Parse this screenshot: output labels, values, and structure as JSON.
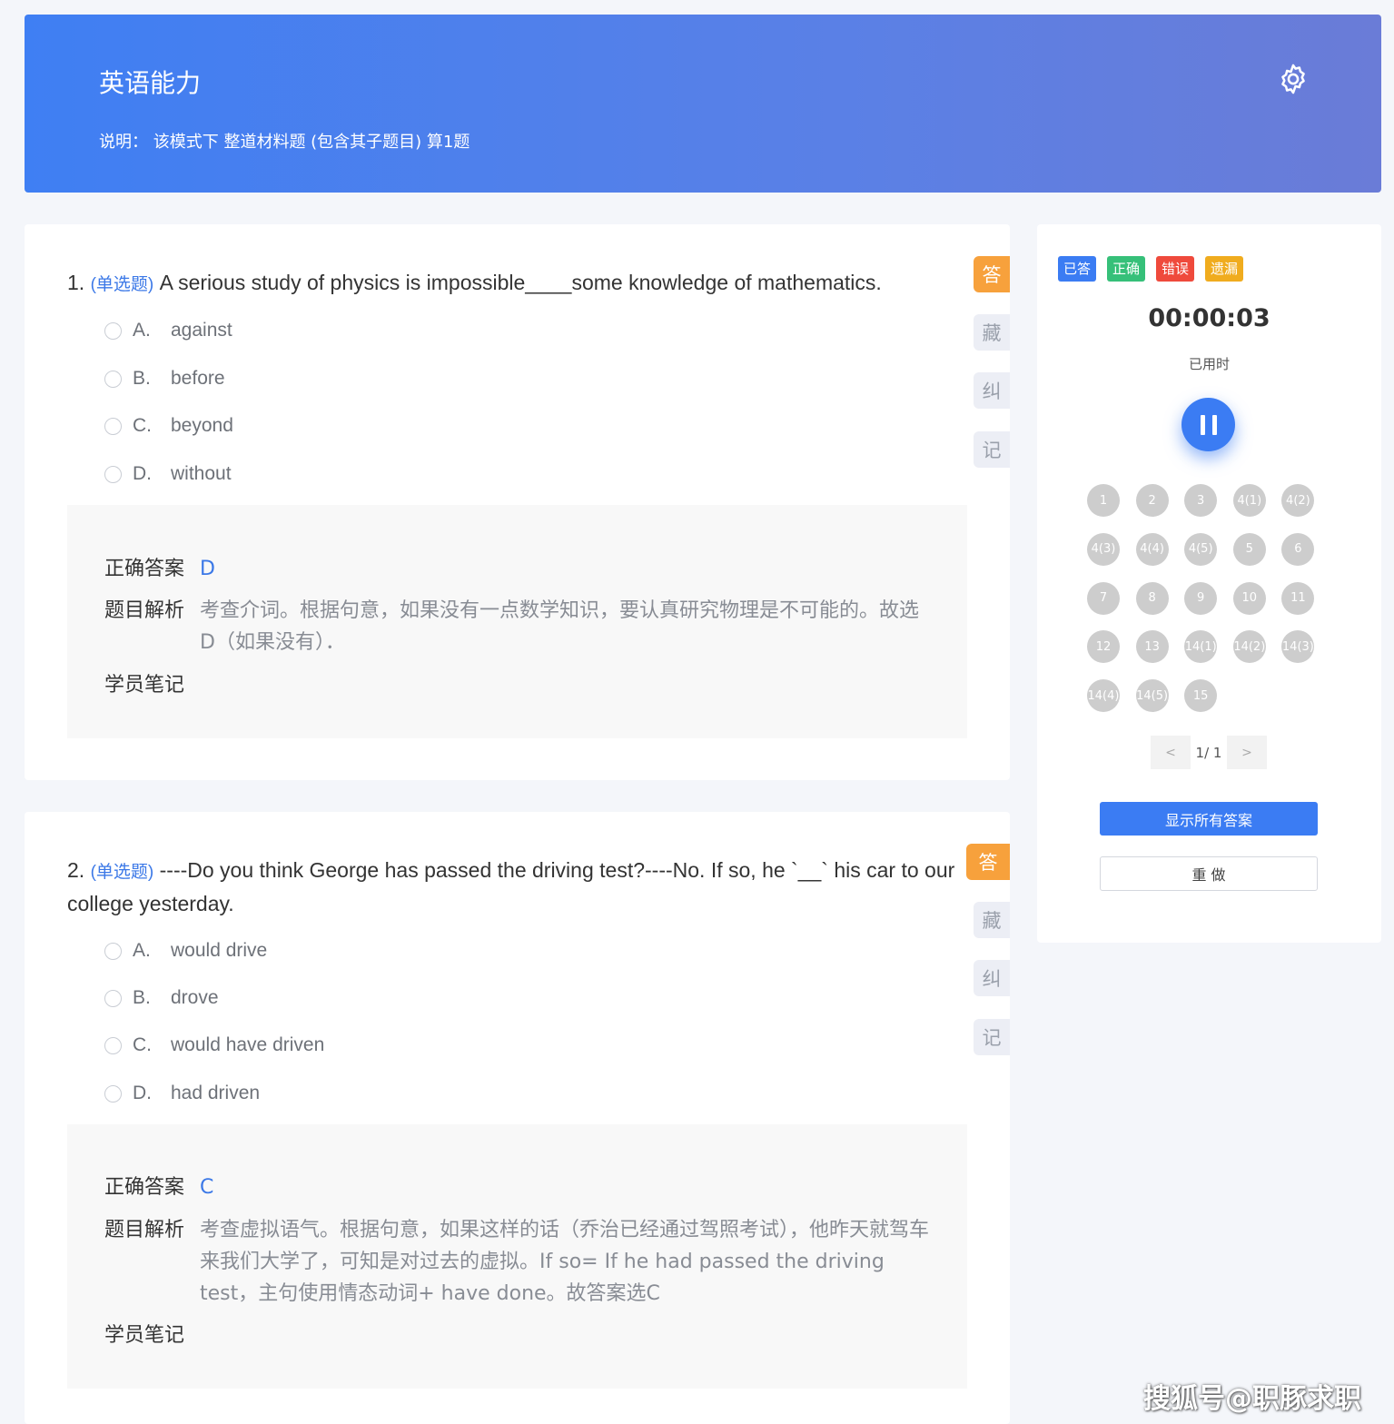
{
  "header": {
    "title": "英语能力",
    "description": "说明：  该模式下 整道材料题 (包含其子题目) 算1题",
    "settings_icon": "gear-icon"
  },
  "side_buttons": [
    "答",
    "藏",
    "纠",
    "记"
  ],
  "questions": [
    {
      "number": "1.",
      "type": "(单选题)",
      "stem": "A serious study of physics is impossible____some knowledge of mathematics.",
      "options": [
        {
          "letter": "A.",
          "text": "against"
        },
        {
          "letter": "B.",
          "text": "before"
        },
        {
          "letter": "C.",
          "text": "beyond"
        },
        {
          "letter": "D.",
          "text": "without"
        }
      ],
      "answer_label": "正确答案",
      "answer": "D",
      "analysis_label": "题目解析",
      "analysis": "考查介词。根据句意，如果没有一点数学知识，要认真研究物理是不可能的。故选D（如果没有）．",
      "notes_label": "学员笔记"
    },
    {
      "number": "2.",
      "type": "(单选题)",
      "stem": "----Do you think George has passed the driving test?----No. If so, he `__` his car to our college yesterday.",
      "options": [
        {
          "letter": "A.",
          "text": "would drive"
        },
        {
          "letter": "B.",
          "text": "drove"
        },
        {
          "letter": "C.",
          "text": "would have driven"
        },
        {
          "letter": "D.",
          "text": "had driven"
        }
      ],
      "answer_label": "正确答案",
      "answer": "C",
      "analysis_label": "题目解析",
      "analysis": "考查虚拟语气。根据句意，如果这样的话（乔治已经通过驾照考试），他昨天就驾车来我们大学了，可知是对过去的虚拟。If so= If he had passed the driving test，主句使用情态动词+ have done。故答案选C",
      "notes_label": "学员笔记"
    }
  ],
  "panel": {
    "legend": [
      {
        "label": "已答",
        "color": "#3b7cf3"
      },
      {
        "label": "正确",
        "color": "#36c079"
      },
      {
        "label": "错误",
        "color": "#ef4a3c"
      },
      {
        "label": "遗漏",
        "color": "#f0ac1e"
      }
    ],
    "timer": "00:00:03",
    "timer_label": "已用时",
    "question_numbers": [
      "1",
      "2",
      "3",
      "4(1)",
      "4(2)",
      "4(3)",
      "4(4)",
      "4(5)",
      "5",
      "6",
      "7",
      "8",
      "9",
      "10",
      "11",
      "12",
      "13",
      "14(1)",
      "14(2)",
      "14(3)",
      "14(4)",
      "14(5)",
      "15"
    ],
    "pager": {
      "prev": "<",
      "info": "1/ 1",
      "next": ">"
    },
    "show_all_label": "显示所有答案",
    "redo_label": "重 做"
  },
  "watermark": "搜狐号@职豚求职"
}
